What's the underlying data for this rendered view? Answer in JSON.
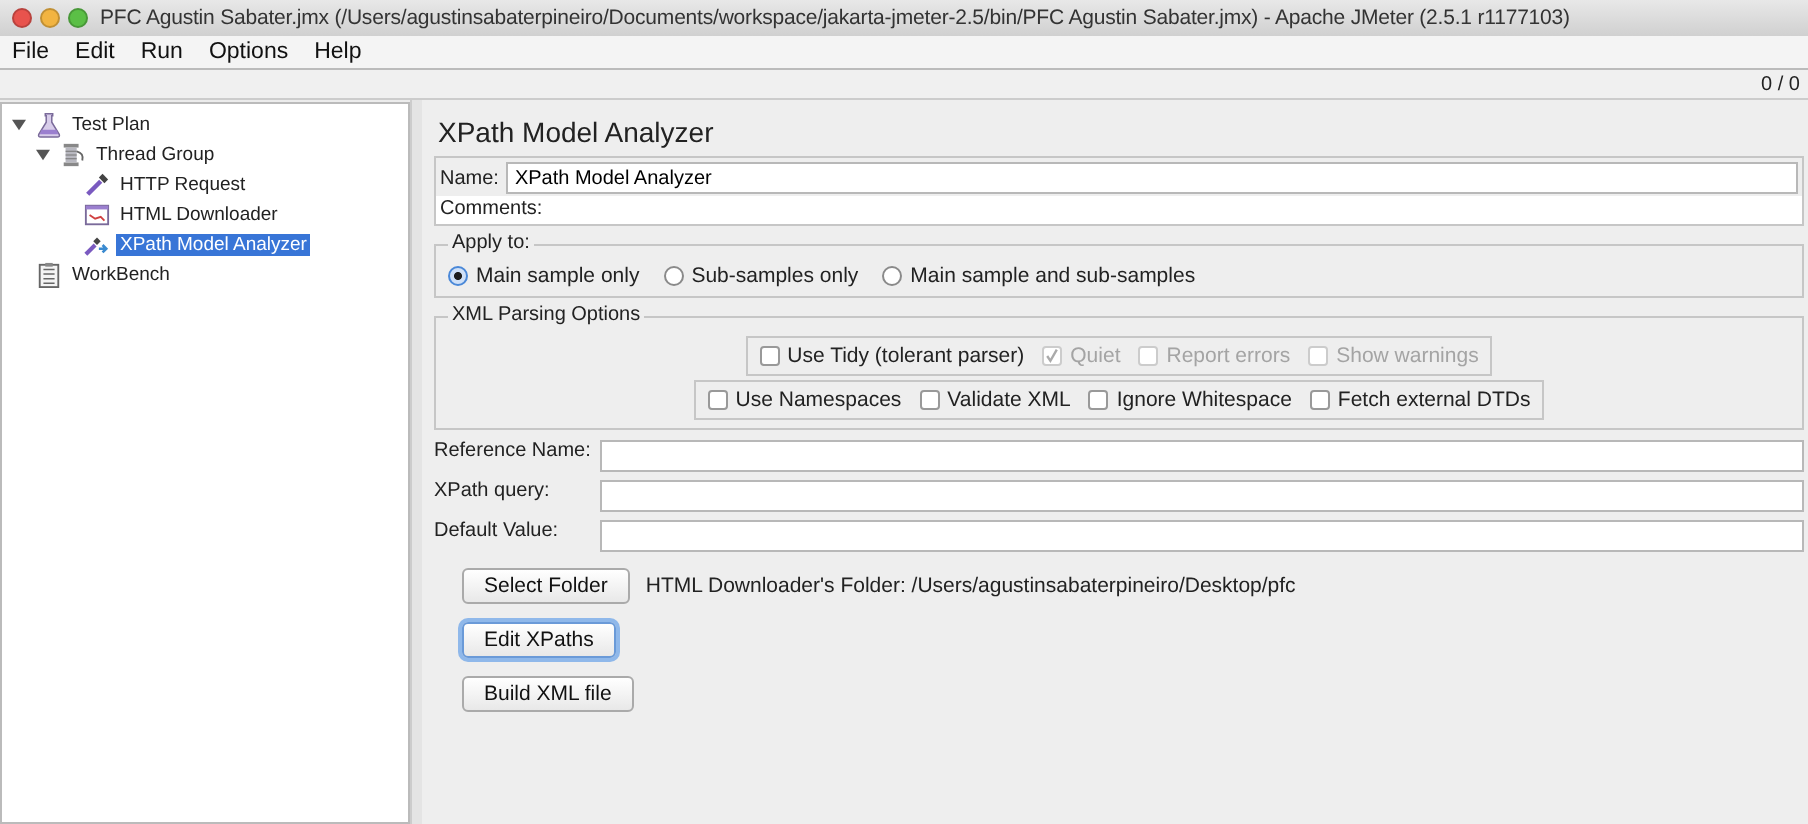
{
  "window": {
    "title": "PFC Agustin Sabater.jmx (/Users/agustinsabaterpineiro/Documents/workspace/jakarta-jmeter-2.5/bin/PFC Agustin Sabater.jmx) - Apache JMeter (2.5.1 r1177103)"
  },
  "menu": [
    "File",
    "Edit",
    "Run",
    "Options",
    "Help"
  ],
  "counter": "0 / 0",
  "tree": [
    {
      "label": "Test Plan",
      "kind": "plan",
      "expanded": true,
      "selected": false,
      "children": [
        {
          "label": "Thread Group",
          "kind": "group",
          "expanded": true,
          "selected": false,
          "children": [
            {
              "label": "HTTP Request",
              "kind": "sampler",
              "selected": false
            },
            {
              "label": "HTML Downloader",
              "kind": "downloader",
              "selected": false
            },
            {
              "label": "XPath Model Analyzer",
              "kind": "analyzer",
              "selected": true
            }
          ]
        }
      ]
    },
    {
      "label": "WorkBench",
      "kind": "workbench",
      "selected": false
    }
  ],
  "panel": {
    "title": "XPath Model Analyzer",
    "name_label": "Name:",
    "name_value": "XPath Model Analyzer",
    "comments_label": "Comments:",
    "apply_to": {
      "legend": "Apply to:",
      "options": [
        {
          "label": "Main sample only",
          "selected": true
        },
        {
          "label": "Sub-samples only",
          "selected": false
        },
        {
          "label": "Main sample and sub-samples",
          "selected": false
        }
      ]
    },
    "xml_options": {
      "legend": "XML Parsing Options",
      "row_1": [
        {
          "label": "Use Tidy (tolerant parser)",
          "checked": false,
          "disabled": false
        },
        {
          "label": "Quiet",
          "checked": true,
          "disabled": true
        },
        {
          "label": "Report errors",
          "checked": false,
          "disabled": true
        },
        {
          "label": "Show warnings",
          "checked": false,
          "disabled": true
        }
      ],
      "row_2": [
        {
          "label": "Use Namespaces",
          "checked": false,
          "disabled": false
        },
        {
          "label": "Validate XML",
          "checked": false,
          "disabled": false
        },
        {
          "label": "Ignore Whitespace",
          "checked": false,
          "disabled": false
        },
        {
          "label": "Fetch external DTDs",
          "checked": false,
          "disabled": false
        }
      ]
    },
    "fields": [
      {
        "label": "Reference Name:"
      },
      {
        "label": "XPath query:"
      },
      {
        "label": "Default Value:"
      }
    ],
    "folder_button": "Select Folder",
    "folder_text": "HTML Downloader's Folder: /Users/agustinsabaterpineiro/Desktop/pfc",
    "buttons": [
      {
        "label": "Edit XPaths",
        "focused": true
      },
      {
        "label": "Build XML file",
        "focused": false
      }
    ]
  }
}
